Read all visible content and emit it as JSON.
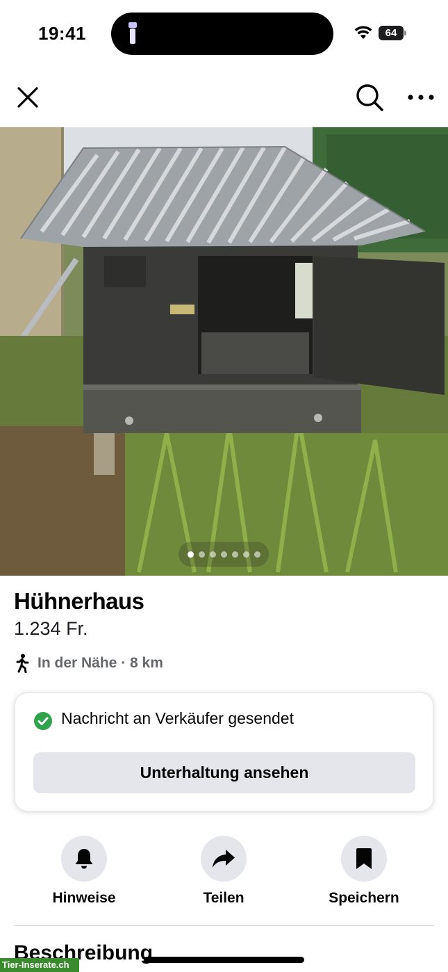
{
  "status_bar": {
    "time": "19:41",
    "battery": "64",
    "icons": [
      "flashlight-icon",
      "wifi-icon",
      "battery-icon"
    ]
  },
  "nav": {
    "icons": [
      "close-icon",
      "search-icon",
      "more-icon"
    ]
  },
  "listing": {
    "title": "Hühnerhaus",
    "price": "1.234 Fr.",
    "distance": "In der Nähe · 8 km",
    "photo_count": 7,
    "active_photo": 1
  },
  "message_card": {
    "status": "Nachricht an Verkäufer gesendet",
    "button": "Unterhaltung ansehen",
    "accent": "#31a24c"
  },
  "actions": [
    {
      "label": "Hinweise",
      "icon": "bell-icon"
    },
    {
      "label": "Teilen",
      "icon": "share-icon"
    },
    {
      "label": "Speichern",
      "icon": "bookmark-icon"
    }
  ],
  "section": {
    "title": "Beschreibung"
  },
  "watermark": "Tier-Inserate.ch"
}
